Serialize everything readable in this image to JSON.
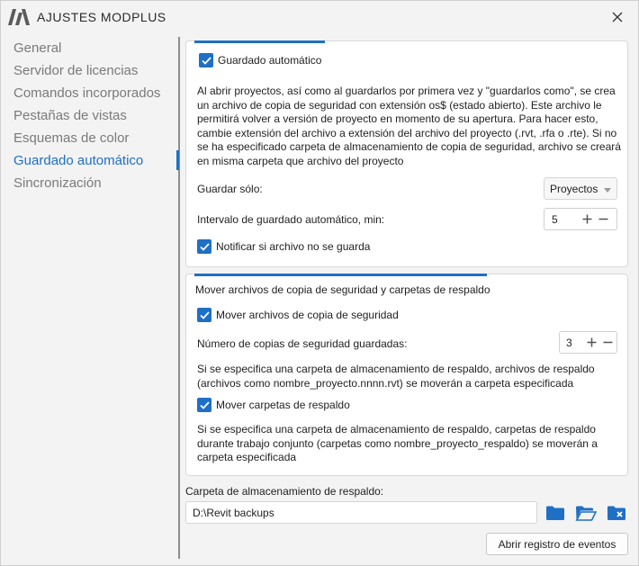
{
  "window": {
    "title": "AJUSTES MODPLUS"
  },
  "sidebar": {
    "items": [
      {
        "label": "General"
      },
      {
        "label": "Servidor de licencias"
      },
      {
        "label": "Comandos incorporados"
      },
      {
        "label": "Pestañas de vistas"
      },
      {
        "label": "Esquemas de color"
      },
      {
        "label": "Guardado automático"
      },
      {
        "label": "Sincronización"
      }
    ],
    "active_index": 5
  },
  "autosave": {
    "enabled_label": "Guardado automático",
    "enabled_checked": true,
    "description": [
      "Al abrir proyectos, así como al guardarlos por primera vez y \"guardarlos como\", se crea",
      "un archivo de copia de seguridad con extensión os$ (estado abierto). Este archivo le",
      "permitirá volver a versión de proyecto en momento de su apertura. Para hacer esto,",
      "cambie extensión del archivo a extensión del archivo del proyecto (.rvt, .rfa o .rte). Si no",
      "se ha especificado carpeta de almacenamiento de copia de seguridad, archivo se creará",
      "en misma carpeta que archivo del proyecto"
    ],
    "save_only_label": "Guardar sólo:",
    "save_only_value": "Proyectos",
    "interval_label": "Intervalo de guardado automático, min:",
    "interval_value": "5",
    "notify_label": "Notificar si archivo no se guarda",
    "notify_checked": true
  },
  "backup": {
    "section_title": "Mover archivos de copia de seguridad y carpetas de respaldo",
    "move_files_label": "Mover archivos de copia de seguridad",
    "move_files_checked": true,
    "copies_label": "Número de copias de seguridad guardadas:",
    "copies_value": "3",
    "files_description": [
      "Si se especifica una carpeta de almacenamiento de respaldo, archivos de respaldo",
      "(archivos como nombre_proyecto.nnnn.rvt) se moverán a carpeta especificada"
    ],
    "move_folders_label": "Mover carpetas de respaldo",
    "move_folders_checked": true,
    "folders_description": [
      "Si se especifica una carpeta de almacenamiento de respaldo, carpetas de respaldo",
      "durante trabajo conjunto (carpetas como nombre_proyecto_respaldo) se moverán a",
      "carpeta especificada"
    ]
  },
  "storage": {
    "label": "Carpeta de almacenamiento de respaldo:",
    "path_value": "D:\\Revit backups"
  },
  "footer": {
    "events_button": "Abrir registro de eventos"
  },
  "colors": {
    "accent": "#1f6fc5",
    "sidebar_text": "#7a7a7a",
    "text": "#1f1f1f"
  }
}
